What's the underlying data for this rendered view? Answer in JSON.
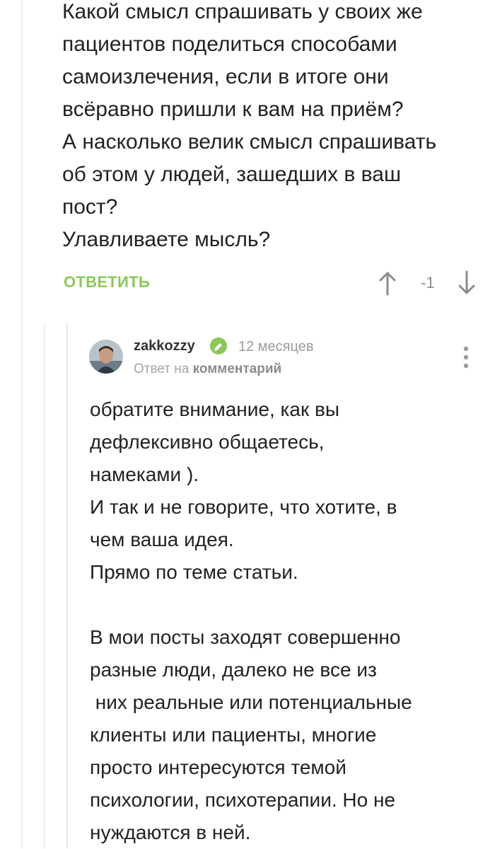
{
  "parent_comment": {
    "lines": [
      "Какой смысл спрашивать у своих же",
      "пациентов поделиться способами",
      "самоизлечения, если в итоге они",
      "всёравно пришли к вам на приём?",
      "А насколько велик смысл спрашивать",
      "об этом у людей, зашедших в ваш",
      "пост?",
      "Улавливаете мысль?"
    ],
    "reply_label": "ОТВЕТИТЬ",
    "rating": "-1"
  },
  "reply_comment": {
    "username": "zakkozzy",
    "time": "12 месяцев",
    "reply_to_prefix": "Ответ на",
    "reply_to_link": "комментарий",
    "lines": [
      "обратите внимание, как вы",
      "дефлексивно общаетесь,",
      "намеками ).",
      "И так и не говорите, что хотите, в",
      "чем ваша идея.",
      "Прямо по теме статьи.",
      "",
      "В мои посты заходят совершенно",
      "разные люди, далеко не все из",
      " них реальные или потенциальные",
      "клиенты или пациенты, многие",
      "просто интересуются темой",
      "психологии, психотерапии. Но не",
      "нуждаются в ней."
    ]
  },
  "colors": {
    "accent_green": "#8ac858",
    "muted_gray": "#9b9b9b",
    "thread_line": "#ececec"
  },
  "icons": {
    "vote_up": "arrow-up-icon",
    "vote_down": "arrow-down-icon",
    "verified": "verified-check-icon",
    "more": "more-vertical-icon"
  }
}
